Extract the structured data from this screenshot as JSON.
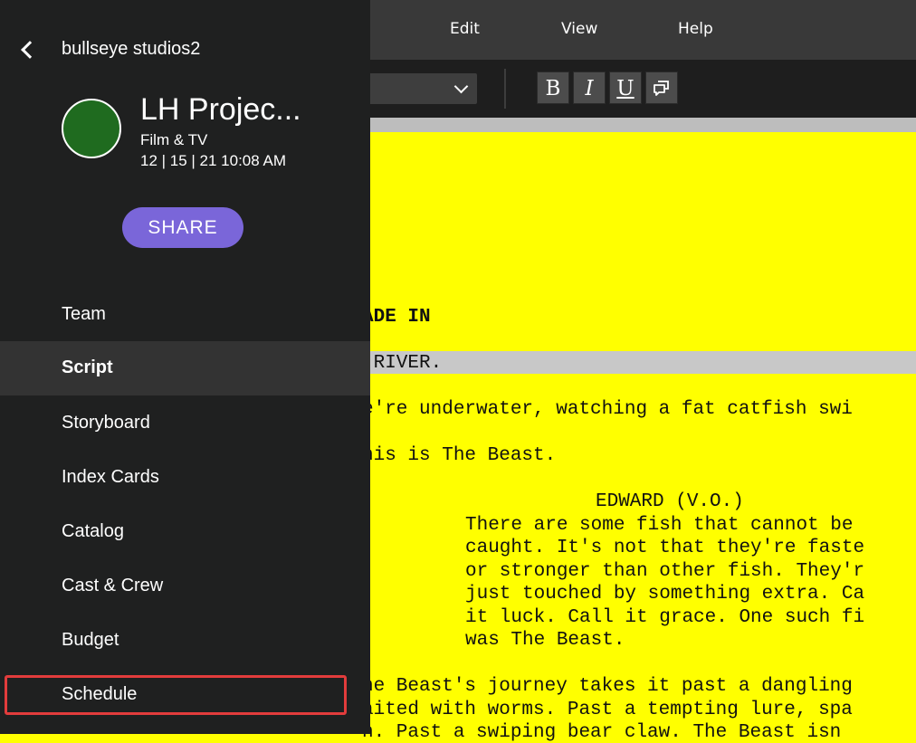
{
  "menu": {
    "edit": "Edit",
    "view": "View",
    "help": "Help"
  },
  "toolbar": {
    "format_dropdown": "",
    "bold": "B",
    "italic": "I",
    "underline": "U",
    "comment_icon": "comment-icon"
  },
  "script": {
    "lines": [
      "ADE IN",
      " RIVER.",
      "e're underwater, watching a fat catfish swi",
      "his is The Beast.",
      "EDWARD (V.O.)",
      "There are some fish that cannot be",
      "caught. It's not that they're faste",
      "or stronger than other fish. They'r",
      "just touched by something extra. Ca",
      "it luck. Call it grace. One such fi",
      "was The Beast.",
      "he Beast's journey takes it past a dangling",
      "aited with worms. Past a tempting lure, spa",
      "n. Past a swiping bear claw. The Beast isn"
    ]
  },
  "sidebar": {
    "back_icon": "chevron-left-icon",
    "org_name": "bullseye studios2",
    "project": {
      "title": "LH Projec...",
      "type": "Film & TV",
      "date": "12 | 15 | 21 10:08 AM",
      "avatar_color": "#1f6b1f"
    },
    "share_label": "SHARE",
    "share_color": "#7a66d9",
    "nav": [
      {
        "label": "Team"
      },
      {
        "label": "Script",
        "active": true
      },
      {
        "label": "Storyboard"
      },
      {
        "label": "Index Cards"
      },
      {
        "label": "Catalog"
      },
      {
        "label": "Cast & Crew"
      },
      {
        "label": "Budget"
      },
      {
        "label": "Schedule",
        "highlighted": true
      }
    ]
  },
  "colors": {
    "page_bg": "#ffff00",
    "sidebar_bg": "#1f2020",
    "highlight": "#e23c3c"
  }
}
